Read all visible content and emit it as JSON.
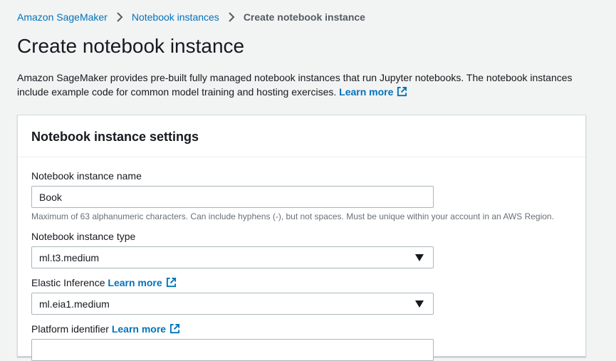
{
  "breadcrumb": {
    "items": [
      {
        "label": "Amazon SageMaker"
      },
      {
        "label": "Notebook instances"
      },
      {
        "label": "Create notebook instance"
      }
    ]
  },
  "page": {
    "title": "Create notebook instance",
    "description": "Amazon SageMaker provides pre-built fully managed notebook instances that run Jupyter notebooks. The notebook instances include example code for common model training and hosting exercises.",
    "learn_more": "Learn more"
  },
  "panel": {
    "title": "Notebook instance settings",
    "name_field": {
      "label": "Notebook instance name",
      "value": "Book",
      "hint": "Maximum of 63 alphanumeric characters. Can include hyphens (-), but not spaces. Must be unique within your account in an AWS Region."
    },
    "instance_type": {
      "label": "Notebook instance type",
      "selected": "ml.t3.medium"
    },
    "elastic_inference": {
      "label": "Elastic Inference",
      "learn_more": "Learn more",
      "selected": "ml.eia1.medium"
    },
    "platform_identifier": {
      "label": "Platform identifier",
      "learn_more": "Learn more"
    }
  },
  "colors": {
    "link": "#0073bb",
    "background": "#f2f3f3",
    "panel": "#ffffff",
    "text": "#16191f",
    "hint": "#687078"
  },
  "icons": [
    "chevron-right-icon",
    "external-link-icon",
    "caret-down-icon"
  ]
}
